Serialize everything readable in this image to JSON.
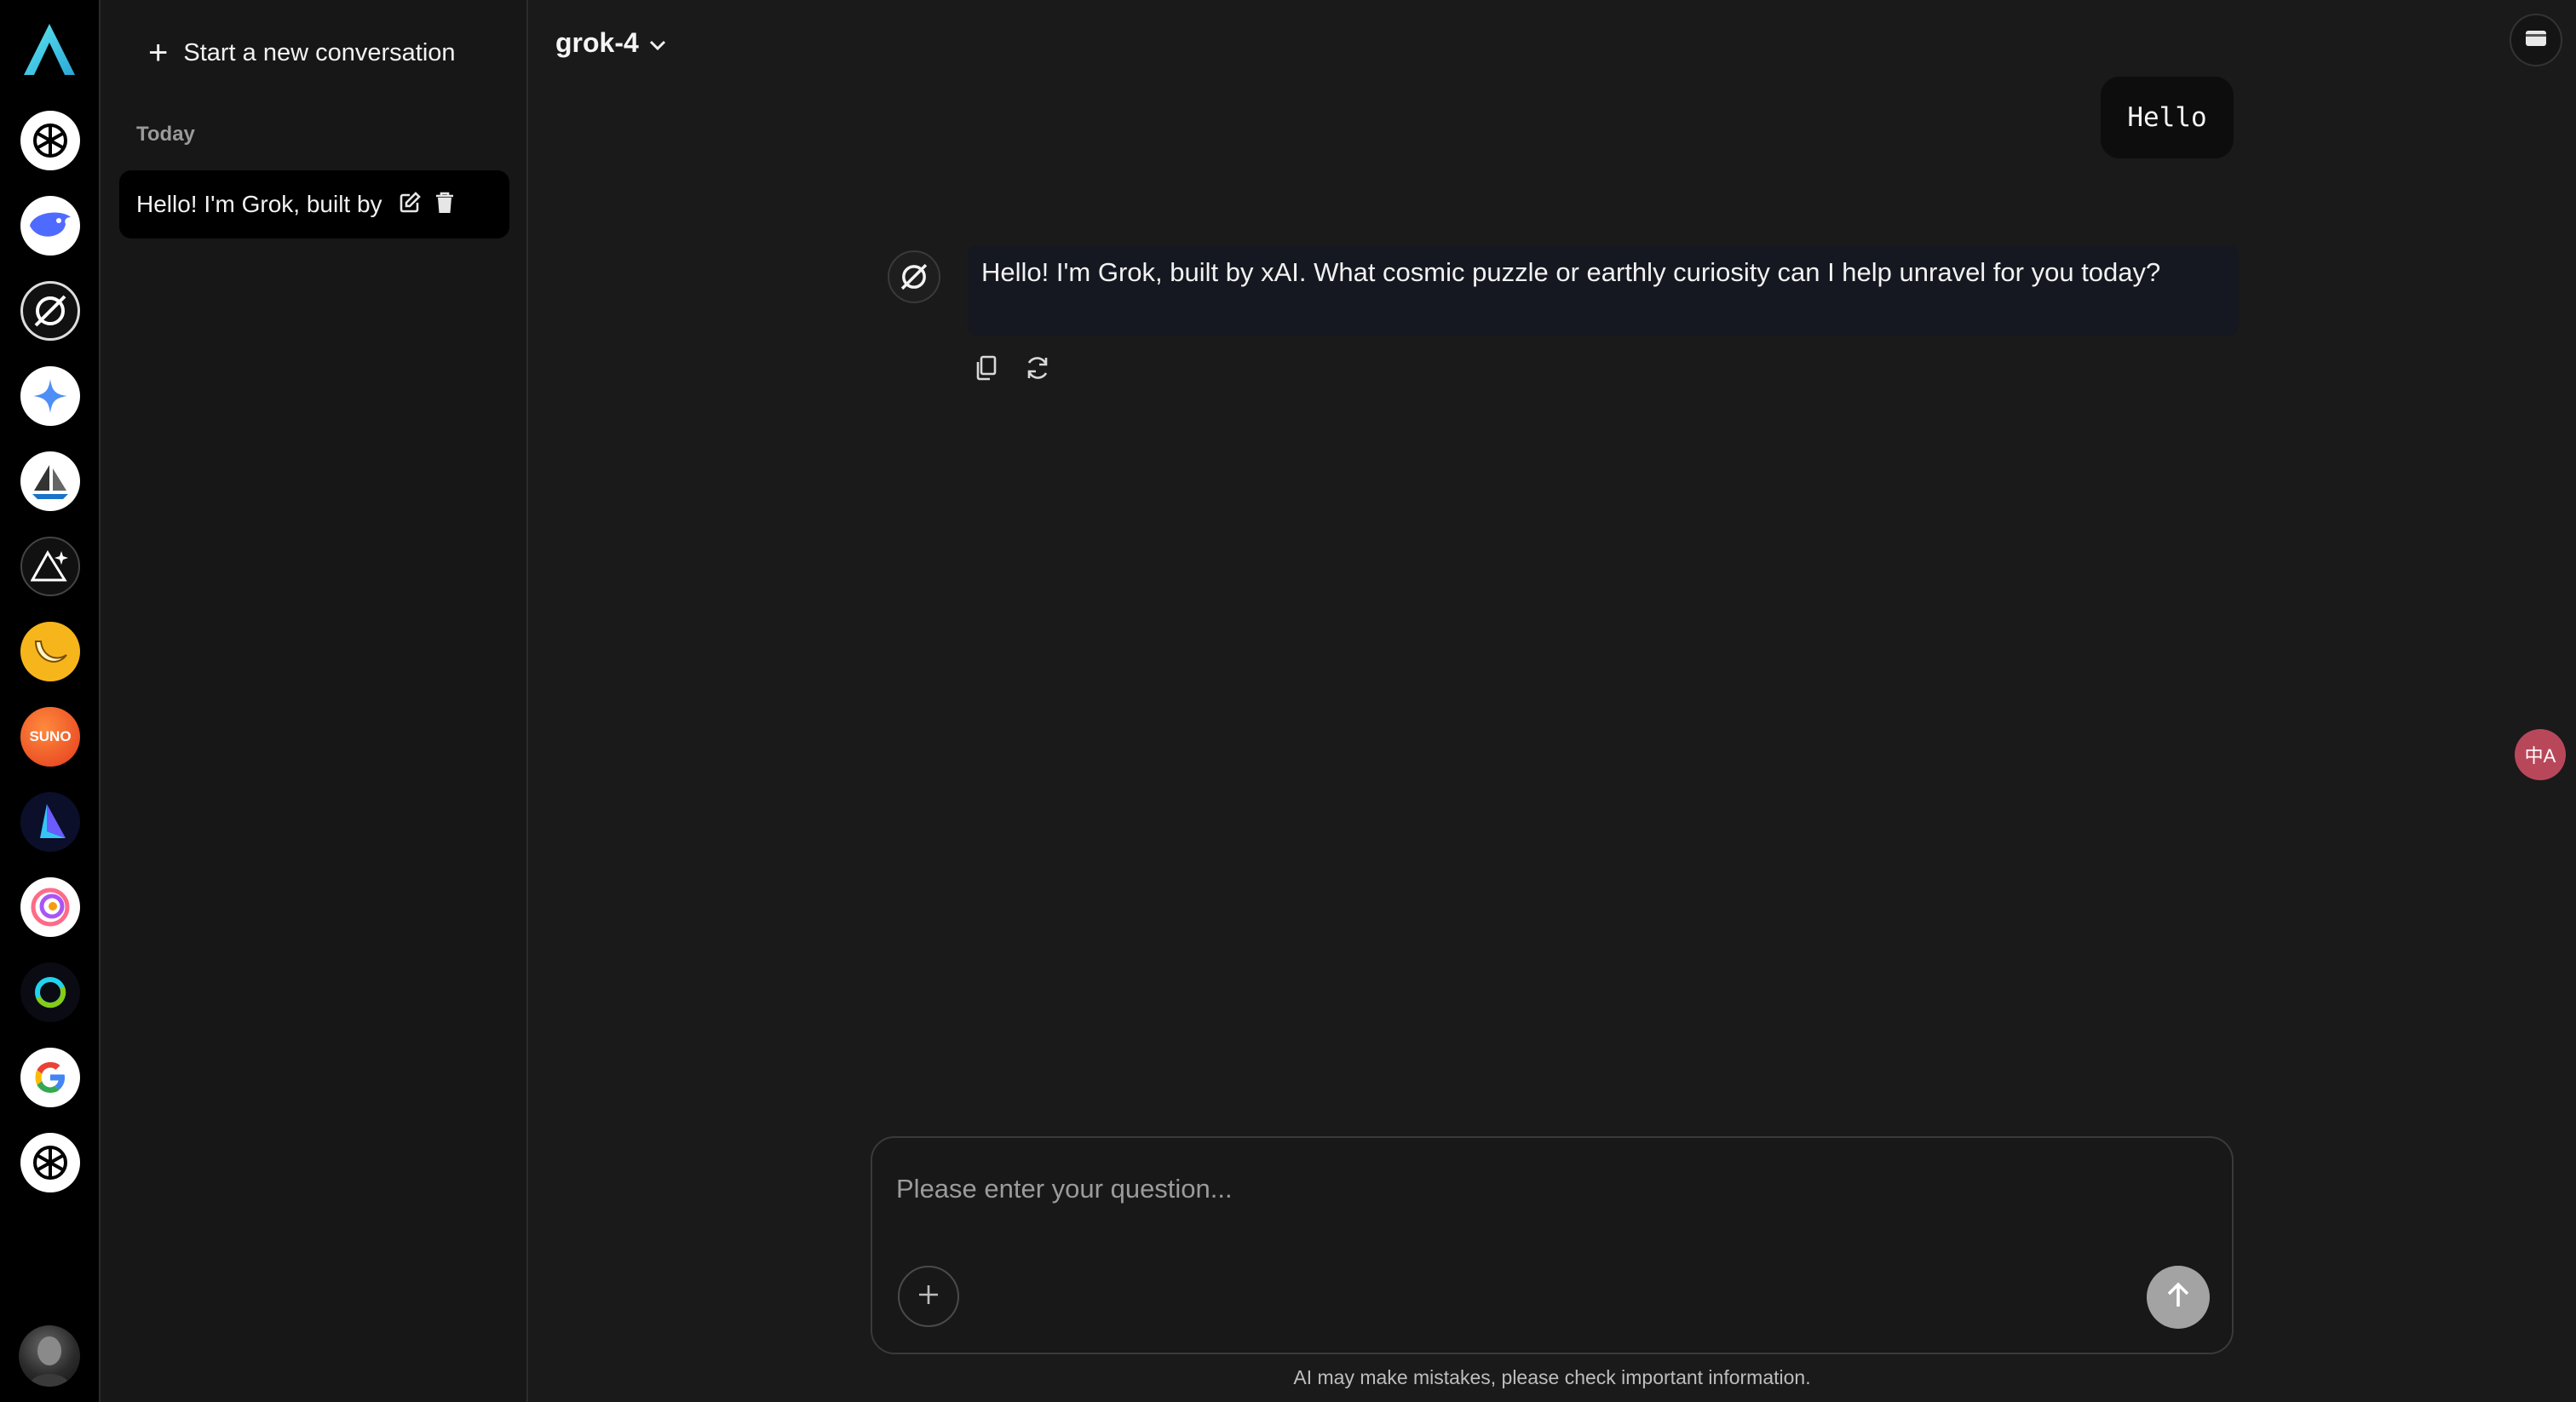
{
  "rail": {
    "apps": [
      {
        "name": "chatgpt-app",
        "icon": "openai-icon"
      },
      {
        "name": "deepseek-app",
        "icon": "whale-icon"
      },
      {
        "name": "grok-app",
        "icon": "grok-icon"
      },
      {
        "name": "gemini-app",
        "icon": "sparkle-icon"
      },
      {
        "name": "midjourney-app",
        "icon": "sailboat-icon"
      },
      {
        "name": "triangle-app",
        "icon": "triangle-sparkle-icon"
      },
      {
        "name": "banana-app",
        "icon": "banana-icon"
      },
      {
        "name": "suno-app",
        "icon": "suno-icon",
        "label": "SUNO"
      },
      {
        "name": "kling-app",
        "icon": "kling-icon"
      },
      {
        "name": "spiral-app",
        "icon": "spiral-icon"
      },
      {
        "name": "ring-app",
        "icon": "ring-icon"
      },
      {
        "name": "google-app",
        "icon": "google-icon"
      },
      {
        "name": "chatgpt-app-2",
        "icon": "openai-icon"
      }
    ],
    "avatar": "user-avatar"
  },
  "sidebar": {
    "new_conversation": "Start a new conversation",
    "section_today": "Today",
    "conversations": [
      {
        "title": "Hello! I'm Grok, built by"
      }
    ]
  },
  "header": {
    "model": "grok-4"
  },
  "chat": {
    "user_message": "Hello",
    "assistant_message": "Hello! I'm Grok, built by xAI. What cosmic puzzle or earthly curiosity can I help unravel for you today?"
  },
  "composer": {
    "placeholder": "Please enter your question...",
    "disclaimer": "AI may make mistakes, please check important information."
  },
  "floating": {
    "translate_label": "中A"
  },
  "colors": {
    "background": "#1a1a1a",
    "rail": "#000000",
    "sidebar": "#171717",
    "send_button": "#a3a3a3",
    "translate": "#b9475a"
  }
}
